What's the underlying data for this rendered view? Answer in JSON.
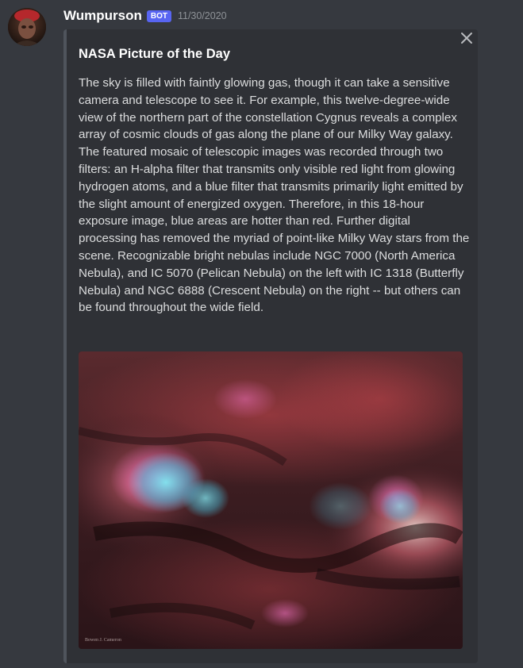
{
  "message": {
    "username": "Wumpurson",
    "bot_tag": "BOT",
    "timestamp": "11/30/2020",
    "avatar_icon": "avatar-icon"
  },
  "embed": {
    "title": "NASA Picture of the Day",
    "description": "The sky is filled with faintly glowing gas, though it can take a sensitive camera and telescope to see it. For example, this twelve-degree-wide view of the northern part of the constellation Cygnus reveals a complex array of cosmic clouds of gas along the plane of our Milky Way galaxy. The featured mosaic of telescopic images was recorded through two filters: an H-alpha filter that transmits only visible red light from glowing hydrogen atoms, and a blue filter that transmits primarily light emitted by the slight amount of energized oxygen. Therefore, in this 18-hour exposure image, blue areas are hotter than red. Further digital processing has removed the myriad of point-like Milky Way stars from the scene. Recognizable bright nebulas include NGC 7000 (North America Nebula), and IC 5070 (Pelican Nebula) on the left with IC 1318 (Butterfly Nebula) and NGC 6888 (Crescent Nebula) on the right -- but others can be found throughout the wide field.",
    "image_credit": "Bowen J. Cameron",
    "close_icon": "close-icon",
    "border_color": "#4f545c"
  },
  "colors": {
    "background": "#36393f",
    "embed_background": "#2f3136",
    "bot_tag": "#5865f2",
    "timestamp": "#8e9297"
  }
}
